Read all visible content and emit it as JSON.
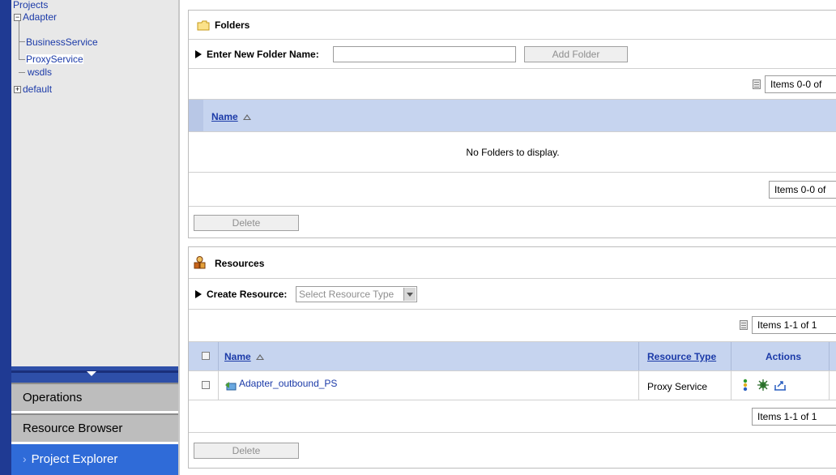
{
  "tree": {
    "root": "Projects",
    "adapter": "Adapter",
    "business_service": "BusinessService",
    "proxy_service": "ProxyService",
    "wsdls": "wsdls",
    "default": "default",
    "expander_minus": "−",
    "expander_plus": "+"
  },
  "nav_tabs": {
    "operations": "Operations",
    "resource_browser": "Resource Browser",
    "project_explorer": "Project Explorer",
    "chevron": "›"
  },
  "folders": {
    "title": "Folders",
    "enter_label": "Enter New Folder Name:",
    "input_value": "",
    "add_button": "Add Folder",
    "pager_top": "Items 0-0 of",
    "pager_bottom": "Items 0-0 of",
    "col_name": "Name",
    "empty_message": "No Folders to display.",
    "delete_button": "Delete"
  },
  "resources": {
    "title": "Resources",
    "create_label": "Create Resource:",
    "select_placeholder": "Select Resource Type",
    "pager_top": "Items 1-1 of 1",
    "pager_bottom": "Items 1-1 of 1",
    "col_name": "Name",
    "col_type": "Resource Type",
    "col_actions": "Actions",
    "rows": [
      {
        "name": "Adapter_outbound_PS",
        "type": "Proxy Service"
      }
    ],
    "delete_button": "Delete"
  },
  "colors": {
    "accent_blue": "#2f6bd8",
    "nav_border": "#1f3a93",
    "header_row": "#c6d4ef",
    "link": "#1b3aa8"
  }
}
